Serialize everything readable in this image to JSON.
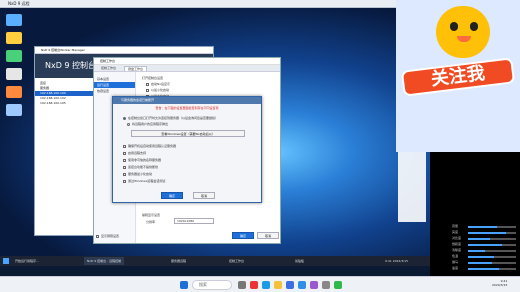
{
  "outer_window": {
    "title": "NxD 9 远程",
    "controls": [
      "minimize",
      "maximize",
      "close"
    ]
  },
  "nxd": {
    "title_bar": "NxD 9 控制台Worker Manager",
    "heading": "NxD 9 控制台",
    "tree": [
      "连接",
      "服务器",
      "192.168.100.100",
      "192.168.100.102",
      "192.168.100.105"
    ],
    "tree_selected": "192.168.100.100"
  },
  "settings": {
    "title": "控制工作台",
    "tabs": [
      "控制工作台",
      "键盘工作台"
    ],
    "tab_active": "键盘工作台",
    "nav": [
      "基本设置",
      "运行设置",
      "热键设置"
    ],
    "nav_active": "运行设置",
    "opts_top": [
      "打开控制台设置",
      "启动Nx后显示",
      "以最小化启动",
      "以最大化启动"
    ],
    "opts_bottom": [
      "编辑显示设置",
      "分辨率"
    ],
    "resolution_value": "1920x1080",
    "checkbox": "显示屏幕设置",
    "btn_ok": "确定",
    "btn_cancel": "取消"
  },
  "dialog": {
    "title": "与服务器的会话已被断开",
    "warning": "警告：在下面的设置里面检查到存在不同设置项",
    "radio1": "在控制台窗口打开时允许连接到服务器（以后会询问您是否要继续）",
    "radio2": "将远程用户的应用程序弹出",
    "action_button": "查看Windows设置（需要Nx启动后以）",
    "options": [
      "确保开机后自动使用远程认证服务器",
      "启用远程支持",
      "使用非可信的名称服务器",
      "遥控台功能不提供断线",
      "服务器最小化启动",
      "通过Windows远程会话测试"
    ],
    "btn_ok": "确定",
    "btn_cancel": "取消"
  },
  "remote_taskbar": [
    "开始运行用程序...",
    "NxD 9 控制台 - 远程控制",
    "服务器远程",
    "控制工作台",
    "剪贴板"
  ],
  "remote_tray_time": "9:41 2024/3/15",
  "local_taskbar": {
    "search_placeholder": "搜索",
    "icons": [
      "start-icon",
      "search-icon",
      "taskview-icon",
      "chrome-icon",
      "edge-icon",
      "explorer-icon",
      "store-icon",
      "mail-icon",
      "app-icon",
      "settings-icon",
      "wechat-icon"
    ],
    "time": "9:41",
    "date": "2024/3/15"
  },
  "follow_badge": "关注我",
  "sliders": [
    {
      "label": "音量",
      "value": 0.6
    },
    {
      "label": "亮度",
      "value": 0.8
    },
    {
      "label": "对比度",
      "value": 0.45
    },
    {
      "label": "饱和度",
      "value": 0.7
    },
    {
      "label": "清晰度",
      "value": 0.35
    },
    {
      "label": "色温",
      "value": 0.55
    },
    {
      "label": "伽马",
      "value": 0.5
    },
    {
      "label": "速度",
      "value": 0.65
    }
  ],
  "colors": {
    "accent": "#1e6fd9",
    "desktop": "#2a7fd6",
    "badge": "#f04b22"
  }
}
